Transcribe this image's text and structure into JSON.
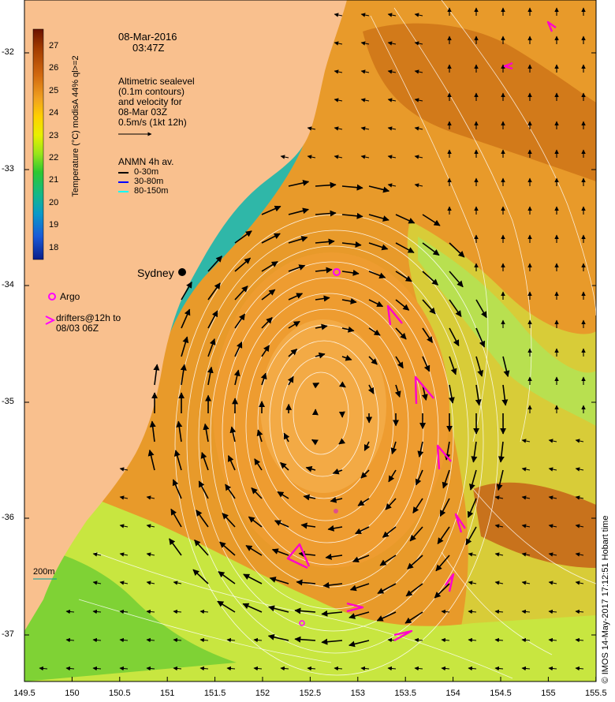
{
  "header": {
    "date": "08-Mar-2016",
    "time": "03:47Z"
  },
  "altimetry_note": {
    "line1": "Altimetric sealevel",
    "line2": "(0.1m contours)",
    "line3": "and velocity for",
    "line4": "08-Mar 03Z",
    "line5": "0.5m/s (1kt 12h)"
  },
  "anmn_legend": {
    "title": "ANMN 4h av.",
    "rows": [
      {
        "label": "0-30m",
        "color": "#000000"
      },
      {
        "label": "30-80m",
        "color": "#0000ff"
      },
      {
        "label": "80-150m",
        "color": "#00ffff"
      }
    ]
  },
  "colorbar": {
    "label": "Temperature (°C) modisA 44% ql>=2",
    "ticks": [
      "27",
      "26",
      "25",
      "24",
      "23",
      "22",
      "21",
      "20",
      "19",
      "18"
    ],
    "colors": [
      "#6b1200",
      "#a03a00",
      "#d2690f",
      "#f0a020",
      "#ffd000",
      "#e8f000",
      "#9ae51a",
      "#2ec830",
      "#13b88a",
      "#0a9ac8",
      "#1a5ad8",
      "#0a1e8a"
    ]
  },
  "place_labels": {
    "sydney": "Sydney",
    "depth": "200m"
  },
  "markers_legend": {
    "argo": "Argo",
    "drifters_line1": "drifters@12h to",
    "drifters_line2": "08/03 06Z",
    "drifter_symbol": ">"
  },
  "axes": {
    "y_ticks": [
      "-32",
      "-33",
      "-34",
      "-35",
      "-36",
      "-37"
    ],
    "x_ticks": [
      "149.5",
      "150",
      "150.5",
      "151",
      "151.5",
      "152",
      "152.5",
      "153",
      "153.5",
      "154",
      "154.5",
      "155",
      "155.5"
    ]
  },
  "credit": "© IMOS 14-May-2017 17:12:51 Hobart time",
  "colors": {
    "land": "#f9c08e",
    "warm_water": "#e89a2a",
    "eddy_core": "#f0a43a",
    "cool_water": "#c8e640",
    "coastal": "#2fb7a8",
    "argo": "#ff00ff",
    "drifter": "#ff00cc"
  }
}
